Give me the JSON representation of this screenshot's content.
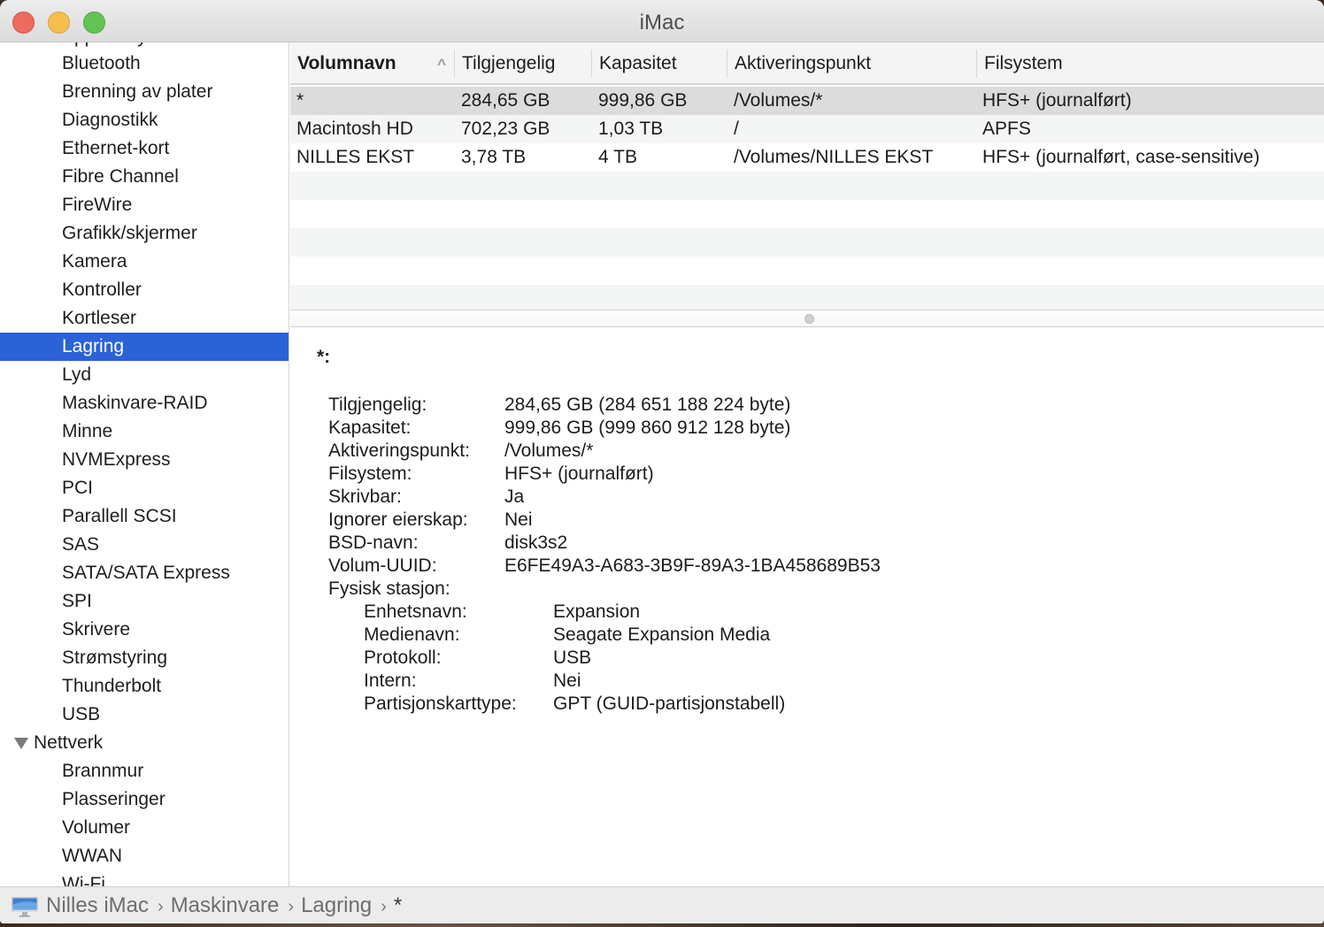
{
  "window": {
    "title": "iMac"
  },
  "sidebar": {
    "partial_top_item": "Apple Pay",
    "items": [
      {
        "label": "Bluetooth"
      },
      {
        "label": "Brenning av plater"
      },
      {
        "label": "Diagnostikk"
      },
      {
        "label": "Ethernet-kort"
      },
      {
        "label": "Fibre Channel"
      },
      {
        "label": "FireWire"
      },
      {
        "label": "Grafikk/skjermer"
      },
      {
        "label": "Kamera"
      },
      {
        "label": "Kontroller"
      },
      {
        "label": "Kortleser"
      },
      {
        "label": "Lagring",
        "selected": true
      },
      {
        "label": "Lyd"
      },
      {
        "label": "Maskinvare-RAID"
      },
      {
        "label": "Minne"
      },
      {
        "label": "NVMExpress"
      },
      {
        "label": "PCI"
      },
      {
        "label": "Parallell SCSI"
      },
      {
        "label": "SAS"
      },
      {
        "label": "SATA/SATA Express"
      },
      {
        "label": "SPI"
      },
      {
        "label": "Skrivere"
      },
      {
        "label": "Strømstyring"
      },
      {
        "label": "Thunderbolt"
      },
      {
        "label": "USB"
      }
    ],
    "group": {
      "label": "Nettverk",
      "expanded": true
    },
    "group_items": [
      {
        "label": "Brannmur"
      },
      {
        "label": "Plasseringer"
      },
      {
        "label": "Volumer"
      },
      {
        "label": "WWAN"
      },
      {
        "label": "Wi-Fi"
      }
    ]
  },
  "table": {
    "columns": [
      "Volumnavn",
      "Tilgjengelig",
      "Kapasitet",
      "Aktiveringspunkt",
      "Filsystem"
    ],
    "sort_column": "Volumnavn",
    "sort_direction": "ascending",
    "rows": [
      [
        "*",
        "284,65 GB",
        "999,86 GB",
        "/Volumes/*",
        "HFS+ (journalført)"
      ],
      [
        "Macintosh HD",
        "702,23 GB",
        "1,03 TB",
        "/",
        "APFS"
      ],
      [
        "NILLES EKST",
        "3,78 TB",
        "4 TB",
        "/Volumes/NILLES EKST",
        "HFS+ (journalført, case-sensitive)"
      ]
    ],
    "selected_row": 0
  },
  "detail": {
    "title": "*:",
    "fields": [
      {
        "label": "Tilgjengelig:",
        "value": "284,65 GB (284 651 188 224 byte)"
      },
      {
        "label": "Kapasitet:",
        "value": "999,86 GB (999 860 912 128 byte)"
      },
      {
        "label": "Aktiveringspunkt:",
        "value": "/Volumes/*"
      },
      {
        "label": "Filsystem:",
        "value": "HFS+ (journalført)"
      },
      {
        "label": "Skrivbar:",
        "value": "Ja"
      },
      {
        "label": "Ignorer eierskap:",
        "value": "Nei"
      },
      {
        "label": "BSD-navn:",
        "value": "disk3s2"
      },
      {
        "label": "Volum-UUID:",
        "value": "E6FE49A3-A683-3B9F-89A3-1BA458689B53"
      },
      {
        "label": "Fysisk stasjon:",
        "value": ""
      }
    ],
    "physical": [
      {
        "label": "Enhetsnavn:",
        "value": "Expansion"
      },
      {
        "label": "Medienavn:",
        "value": "Seagate Expansion Media"
      },
      {
        "label": "Protokoll:",
        "value": "USB"
      },
      {
        "label": "Intern:",
        "value": "Nei"
      },
      {
        "label": "Partisjonskarttype:",
        "value": "GPT (GUID-partisjonstabell)"
      }
    ]
  },
  "breadcrumb": {
    "icon": "imac-icon",
    "items": [
      "Nilles iMac",
      "Maskinvare",
      "Lagring",
      "*"
    ],
    "separator": "›"
  },
  "colors": {
    "selection": "#2b62d6",
    "close": "#ed6a5e",
    "minimize": "#f5be4f",
    "maximize": "#61c454"
  }
}
